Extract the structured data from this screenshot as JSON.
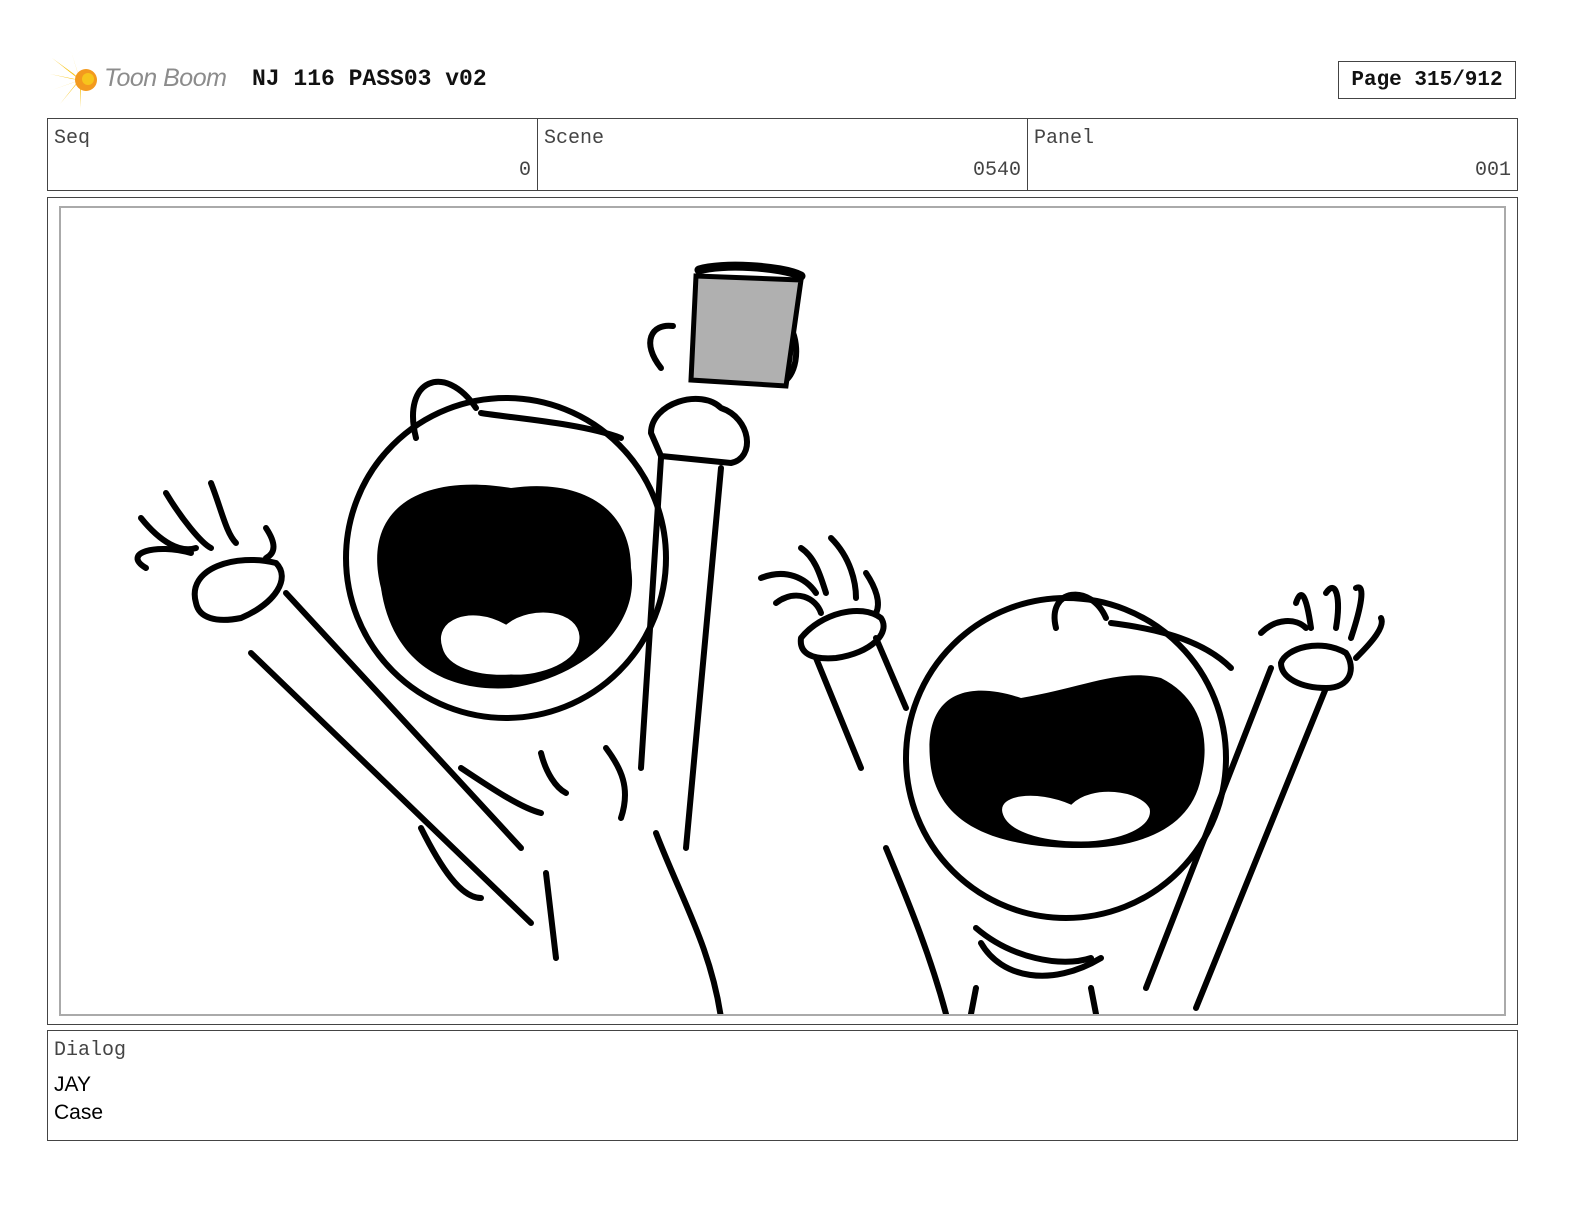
{
  "header": {
    "logo_text": "Toon Boom",
    "title": "NJ 116 PASS03 v02",
    "page": "Page 315/912"
  },
  "info": {
    "seq": {
      "label": "Seq",
      "value": "0"
    },
    "scene": {
      "label": "Scene",
      "value": "0540"
    },
    "panel": {
      "label": "Panel",
      "value": "001"
    }
  },
  "dialog": {
    "label": "Dialog",
    "lines": [
      "JAY",
      "Case"
    ]
  },
  "colors": {
    "logo_yellow": "#f7c51c",
    "logo_orange": "#f39a1e",
    "cup_gray": "#b0b0b0"
  }
}
